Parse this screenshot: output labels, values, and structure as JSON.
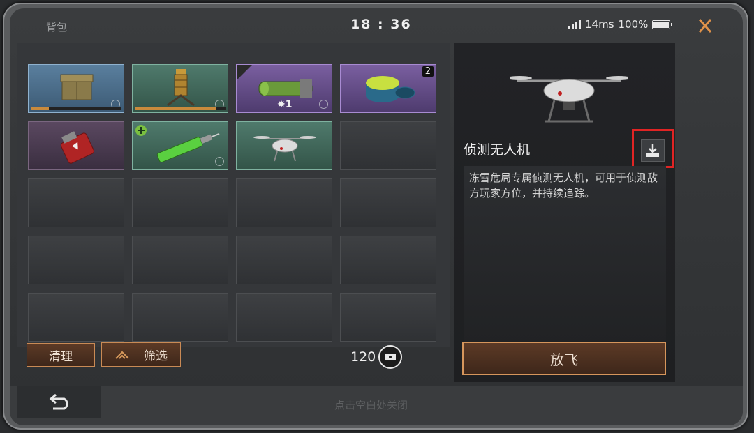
{
  "header": {
    "title": "背包",
    "time": "18 : 36",
    "latency": "14ms",
    "battery": "100%"
  },
  "inventory": {
    "slots": [
      {
        "item": "supply-crate",
        "rarity": "blue",
        "progress": 0.2
      },
      {
        "item": "drill-tower",
        "rarity": "green",
        "progress": 0.9
      },
      {
        "item": "grenade-launcher",
        "rarity": "purple",
        "stars": "1"
      },
      {
        "item": "health-pack",
        "rarity": "purple",
        "count": "2"
      },
      {
        "item": "fire-grenade",
        "rarity": "dark-purple"
      },
      {
        "item": "adrenaline-syringe",
        "rarity": "green"
      },
      {
        "item": "recon-drone",
        "rarity": "green"
      }
    ],
    "clean_label": "清理",
    "filter_label": "筛选",
    "capacity": "120"
  },
  "detail": {
    "name": "侦测无人机",
    "description": "冻雪危局专属侦测无人机，可用于侦测敌方玩家方位，并持续追踪。",
    "action_label": "放飞"
  },
  "footer": {
    "hint": "点击空白处关闭"
  },
  "colors": {
    "accent": "#c98a55",
    "highlight": "#e02424"
  }
}
